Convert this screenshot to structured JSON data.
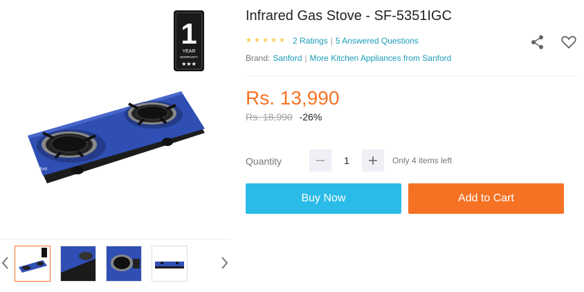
{
  "product": {
    "title": "Infrared Gas Stove - SF-5351IGC",
    "ratings_text": "2 Ratings",
    "questions_text": "5 Answered Questions",
    "brand_label": "Brand:",
    "brand_name": "Sanford",
    "more_from_brand": "More Kitchen Appliances from Sanford",
    "rating_stars": 5,
    "price": "Rs. 13,990",
    "original_price": "Rs. 18,990",
    "discount": "-26%"
  },
  "gallery": {
    "warranty_badge": {
      "number": "1",
      "line1": "YEAR",
      "line2": "WARRANTY",
      "stars": "★★★"
    },
    "stove_brand_text": "sanford",
    "thumbnail_count": 4,
    "active_thumbnail": 1
  },
  "quantity": {
    "label": "Quantity",
    "value": "1",
    "minus": "−",
    "plus": "+",
    "stock_text": "Only 4 items left"
  },
  "actions": {
    "buy_now": "Buy Now",
    "add_to_cart": "Add to Cart"
  },
  "colors": {
    "accent_orange": "#f57224",
    "buy_blue": "#2abbe8",
    "link_teal": "#1a9cb7",
    "star_yellow": "#faca51",
    "stove_blue": "#2f4fb4"
  },
  "icons": {
    "share": "share-icon",
    "wishlist": "heart-icon",
    "prev": "chevron-left-icon",
    "next": "chevron-right-icon"
  }
}
